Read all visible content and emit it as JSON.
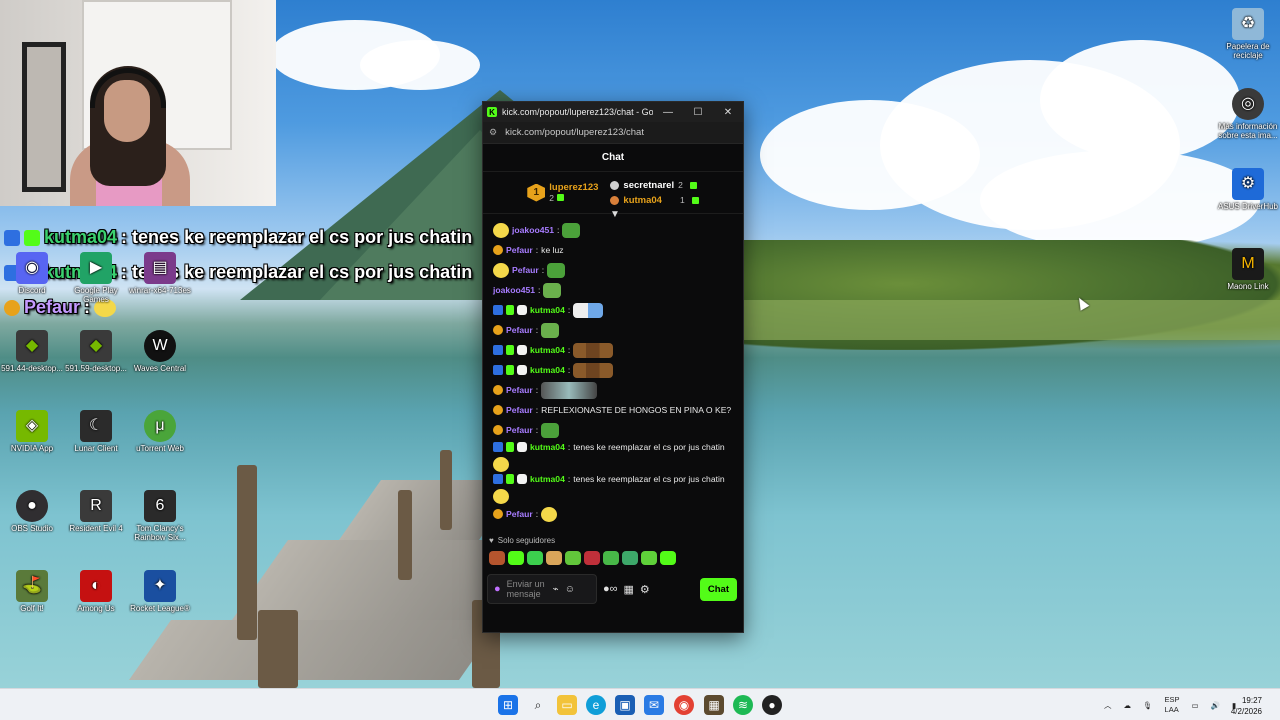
{
  "overlay_chat": [
    {
      "user": "kutma04",
      "text": ": tenes ke reemplazar el cs por jus chatin"
    },
    {
      "user": "kutma04",
      "text": ": tenes ke reemplazar el cs por jus chatin"
    },
    {
      "user": "Pefaur",
      "text": ":"
    }
  ],
  "desktop_icons": [
    {
      "label": "Discord",
      "color": "#5865f2",
      "glyph": "◉"
    },
    {
      "label": "Google Play Games",
      "color": "#21a366",
      "glyph": "▶"
    },
    {
      "label": "winrar-x64-713es",
      "color": "#7b3a8b",
      "glyph": "▤"
    },
    {
      "label": "591.44-desktop...",
      "color": "#76b900",
      "glyph": "◆"
    },
    {
      "label": "591.59-desktop...",
      "color": "#76b900",
      "glyph": "◆"
    },
    {
      "label": "Waves Central",
      "color": "#111111",
      "glyph": "W"
    },
    {
      "label": "NVIDIA App",
      "color": "#76b900",
      "glyph": "◈"
    },
    {
      "label": "Lunar Client",
      "color": "#2b2b2b",
      "glyph": "☾"
    },
    {
      "label": "uTorrent Web",
      "color": "#4aa53a",
      "glyph": "μ"
    },
    {
      "label": "OBS Studio",
      "color": "#302e31",
      "glyph": "●"
    },
    {
      "label": "Resident Evil 4",
      "color": "#3a3a3a",
      "glyph": "R"
    },
    {
      "label": "Tom Clancy's Rainbow Six...",
      "color": "#2a2a2a",
      "glyph": "6"
    },
    {
      "label": "Golf It!",
      "color": "#5a7a3a",
      "glyph": "⛳"
    },
    {
      "label": "Among Us",
      "color": "#c51111",
      "glyph": "◐"
    },
    {
      "label": "Rocket League®",
      "color": "#1a4fa0",
      "glyph": "✦"
    },
    {
      "label": "Papelera de reciclaje",
      "color": "#8fb8d8",
      "glyph": "♻"
    },
    {
      "label": "Más información sobre esta ima...",
      "color": "#3a3a3a",
      "glyph": "◎"
    },
    {
      "label": "ASUS DriverHub",
      "color": "#1e6ad8",
      "glyph": "⚙"
    },
    {
      "label": "Maono Link",
      "color": "#1a1a1a",
      "glyph": "M"
    }
  ],
  "window": {
    "title": "kick.com/popout/luperez123/chat - Googl...",
    "url": "kick.com/popout/luperez123/chat",
    "header": "Chat"
  },
  "gifters": {
    "top": {
      "rank": "1",
      "name": "luperez123",
      "count": "2"
    },
    "others": [
      {
        "name": "secretnarel",
        "count": "2"
      },
      {
        "name": "kutma04",
        "count": "1"
      }
    ]
  },
  "messages": [
    {
      "user": "joakoo451",
      "text": ""
    },
    {
      "user": "Pefaur",
      "text": "ke luz"
    },
    {
      "user": "Pefaur",
      "text": ""
    },
    {
      "user": "joakoo451",
      "text": ""
    },
    {
      "user": "kutma04",
      "text": ""
    },
    {
      "user": "Pefaur",
      "text": ""
    },
    {
      "user": "kutma04",
      "text": ""
    },
    {
      "user": "kutma04",
      "text": ""
    },
    {
      "user": "Pefaur",
      "text": ""
    },
    {
      "user": "Pefaur",
      "text": "REFLEXIONASTE DE HONGOS EN PINA O KE?"
    },
    {
      "user": "Pefaur",
      "text": ""
    },
    {
      "user": "kutma04",
      "text": "tenes ke reemplazar el cs por jus chatin"
    },
    {
      "user": "kutma04",
      "text": "tenes ke reemplazar el cs por jus chatin"
    },
    {
      "user": "Pefaur",
      "text": ""
    }
  ],
  "followers_only": "Solo seguidores",
  "input": {
    "placeholder": "Enviar un mensaje",
    "send_label": "Chat"
  },
  "colors": {
    "kick_green": "#53fc18",
    "name_purple": "#a77cff",
    "gold": "#e7a21b"
  },
  "tray": {
    "lang_top": "ESP",
    "lang_bottom": "LAA",
    "time": "19:27",
    "date": "4/2/2026"
  }
}
